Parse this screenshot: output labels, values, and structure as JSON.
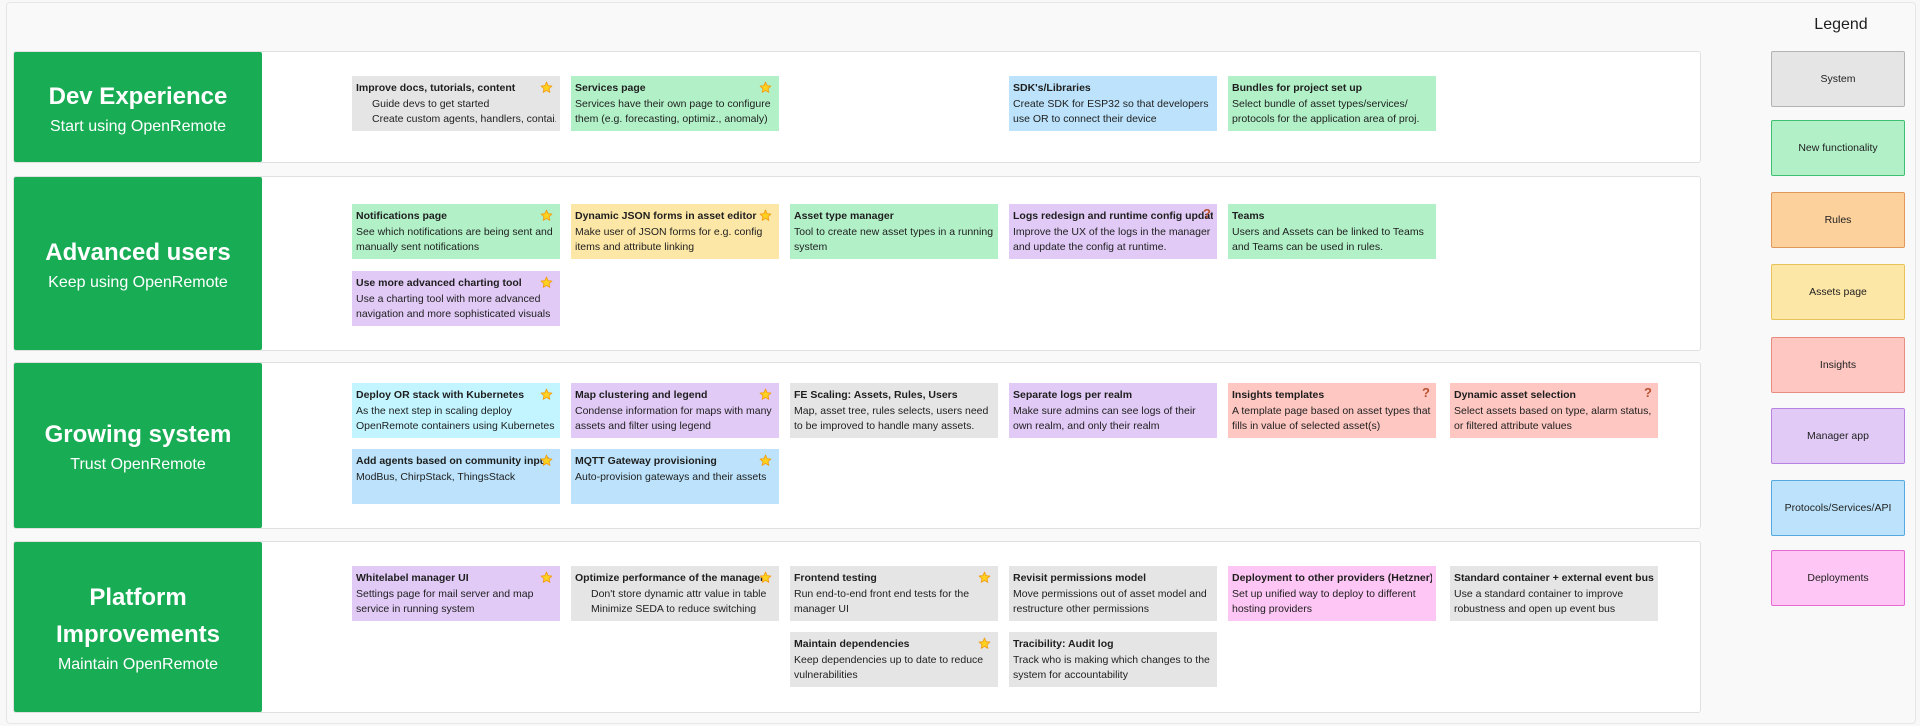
{
  "colors": {
    "row_label": "#18ad55",
    "system": "#e5e5e5",
    "new_functionality": "#b2f1c8",
    "rules": "#fcd19c",
    "assets_page": "#fde7a7",
    "insights": "#fec7c2",
    "manager_app": "#e1caf6",
    "protocols": "#bce3fb",
    "deployments": "#fdc6f4",
    "kubernetes_card": "#c2f5ff"
  },
  "rows": [
    {
      "title": "Dev Experience",
      "subtitle": "Start using OpenRemote",
      "cards": [
        {
          "title": "Improve docs, tutorials, content",
          "bullets": [
            "Guide devs to get started",
            "Create custom agents, handlers, contai."
          ],
          "badge": "star-icon"
        },
        {
          "title": "Services page",
          "desc": "Services have their own page to configure them (e.g. forecasting, optimiz., anomaly)",
          "badge": "star-icon"
        },
        {
          "title": "SDK's/Libraries",
          "desc": "Create SDK for ESP32 so that developers use OR to connect their device"
        },
        {
          "title": "Bundles for project set up",
          "desc": "Select bundle of asset types/services/ protocols for the application area of proj."
        }
      ]
    },
    {
      "title": "Advanced users",
      "subtitle": "Keep using OpenRemote",
      "cards": [
        {
          "title": "Notifications page",
          "desc": "See which notifications are being sent and manually sent notifications",
          "badge": "star-icon"
        },
        {
          "title": "Dynamic JSON forms in asset editor",
          "desc": "Make user of JSON forms for e.g. config items and attribute linking",
          "badge": "star-icon"
        },
        {
          "title": "Asset type manager",
          "desc": "Tool to create new asset types in a running system"
        },
        {
          "title": "Logs redesign and runtime config update",
          "desc": "Improve the UX of the logs in the manager and update the config at runtime.",
          "badge": "question-icon",
          "badge_text": "?"
        },
        {
          "title": "Teams",
          "desc": "Users and Assets can be linked to Teams and Teams can be used in rules."
        },
        {
          "title": "Use more advanced charting tool",
          "desc": "Use a charting tool with more advanced navigation and more sophisticated visuals",
          "badge": "star-icon"
        }
      ]
    },
    {
      "title": "Growing system",
      "subtitle": "Trust OpenRemote",
      "cards": [
        {
          "title": "Deploy OR stack with Kubernetes",
          "desc": "As the next step in scaling deploy OpenRemote containers using Kubernetes",
          "badge": "star-icon"
        },
        {
          "title": "Map clustering and legend",
          "desc": "Condense information for maps with many assets and filter using legend",
          "badge": "star-icon"
        },
        {
          "title": "FE Scaling: Assets, Rules, Users",
          "desc": "Map, asset tree, rules selects, users need to be improved to handle many assets."
        },
        {
          "title": "Separate logs per realm",
          "desc": "Make sure admins can see logs of their own realm, and only their realm"
        },
        {
          "title": "Insights templates",
          "desc": "A template page based on asset types that fills in value of selected asset(s)",
          "badge": "question-icon",
          "badge_text": "?"
        },
        {
          "title": "Dynamic asset selection",
          "desc": "Select assets based on type, alarm status, or filtered attribute values",
          "badge": "question-icon",
          "badge_text": "?"
        },
        {
          "title": "Add agents based on community input",
          "desc": "ModBus, ChirpStack, ThingsStack",
          "badge": "star-icon"
        },
        {
          "title": "MQTT Gateway provisioning",
          "desc": "Auto-provision gateways and their assets",
          "badge": "star-icon"
        }
      ]
    },
    {
      "title": "Platform Improvements",
      "subtitle": "Maintain OpenRemote",
      "cards": [
        {
          "title": "Whitelabel manager UI",
          "desc": "Settings page for mail server and map service in running system",
          "badge": "star-icon"
        },
        {
          "title": "Optimize performance of the manager",
          "bullets": [
            "Don't store dynamic attr value in table",
            "Minimize SEDA to reduce switching"
          ],
          "badge": "star-icon"
        },
        {
          "title": "Frontend testing",
          "desc": "Run end-to-end front end tests for the manager UI",
          "badge": "star-icon"
        },
        {
          "title": "Revisit permissions model",
          "desc": "Move permissions out of asset model and restructure other permissions"
        },
        {
          "title": "Deployment to other providers (Hetzner)",
          "desc": "Set up unified way to deploy to different hosting providers"
        },
        {
          "title": "Standard container + external event bus",
          "desc": "Use a standard container to improve robustness and open up event bus"
        },
        {
          "title": "Maintain dependencies",
          "desc": "Keep dependencies up to date to reduce vulnerabilities",
          "badge": "star-icon"
        },
        {
          "title": "Tracibility: Audit log",
          "desc": "Track who is making which changes to the system for accountability"
        }
      ]
    }
  ],
  "legend": {
    "title": "Legend",
    "items": [
      "System",
      "New functionality",
      "Rules",
      "Assets page",
      "Insights",
      "Manager app",
      "Protocols/Services/API",
      "Deployments"
    ]
  }
}
